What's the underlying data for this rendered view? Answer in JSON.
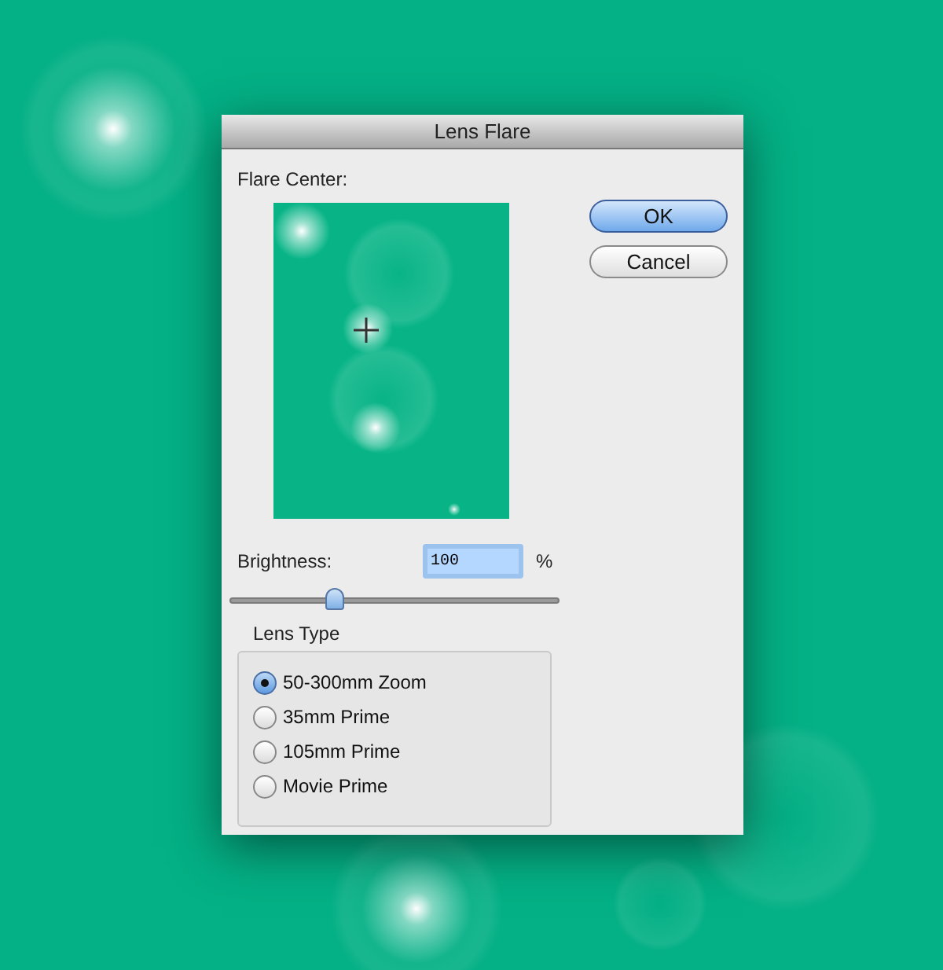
{
  "window": {
    "title": "Lens Flare"
  },
  "flare_center": {
    "label": "Flare Center:"
  },
  "buttons": [
    {
      "label": "OK",
      "default": true
    },
    {
      "label": "Cancel",
      "default": false
    }
  ],
  "brightness": {
    "label": "Brightness:",
    "value": "100",
    "unit": "%",
    "level": 0.32
  },
  "lens_type": {
    "title": "Lens Type",
    "options": [
      {
        "label": "50-300mm Zoom",
        "selected": true
      },
      {
        "label": "35mm Prime",
        "selected": false
      },
      {
        "label": "105mm Prime",
        "selected": false
      },
      {
        "label": "Movie Prime",
        "selected": false
      }
    ]
  }
}
